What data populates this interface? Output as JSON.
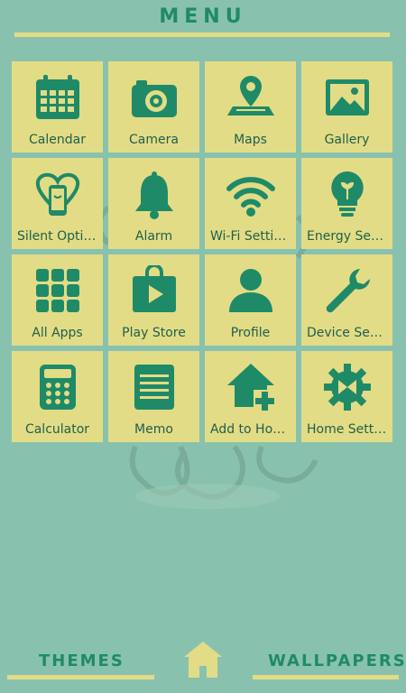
{
  "header": {
    "title": "MENU"
  },
  "tiles": [
    {
      "label": "Calendar",
      "icon": "calendar-icon"
    },
    {
      "label": "Camera",
      "icon": "camera-icon"
    },
    {
      "label": "Maps",
      "icon": "map-pin-icon"
    },
    {
      "label": "Gallery",
      "icon": "gallery-icon"
    },
    {
      "label": "Silent Options",
      "icon": "silent-phone-icon"
    },
    {
      "label": "Alarm",
      "icon": "bell-icon"
    },
    {
      "label": "Wi-Fi Settings",
      "icon": "wifi-icon"
    },
    {
      "label": "Energy Setti…",
      "icon": "lightbulb-icon"
    },
    {
      "label": "All Apps",
      "icon": "apps-grid-icon"
    },
    {
      "label": "Play Store",
      "icon": "play-store-icon"
    },
    {
      "label": "Profile",
      "icon": "person-icon"
    },
    {
      "label": "Device Setti…",
      "icon": "wrench-icon"
    },
    {
      "label": "Calculator",
      "icon": "calculator-icon"
    },
    {
      "label": "Memo",
      "icon": "memo-icon"
    },
    {
      "label": "Add to Home",
      "icon": "add-home-icon"
    },
    {
      "label": "Home Setti…",
      "icon": "gear-icon"
    }
  ],
  "footer": {
    "themes_label": "THEMES",
    "wallpapers_label": "WALLPAPERS",
    "home_icon": "home-icon"
  },
  "colors": {
    "background": "#88c2ae",
    "tile": "#e3dc86",
    "icon": "#1f8a68",
    "text": "#1f5f4c"
  }
}
